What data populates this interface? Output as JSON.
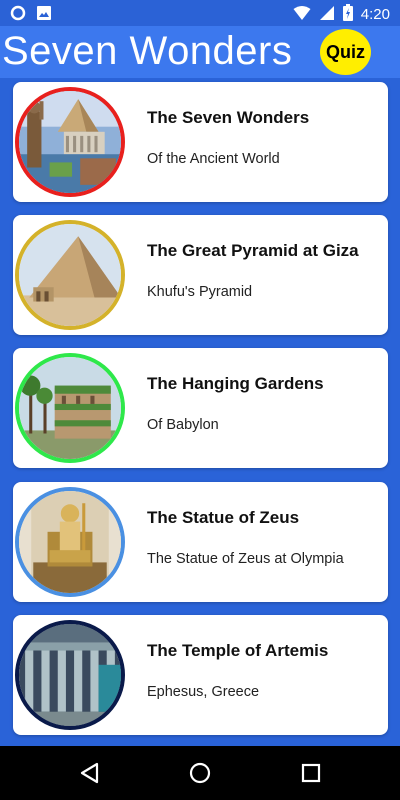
{
  "status_bar": {
    "time": "4:20",
    "left_icons": [
      "circle-notification-icon",
      "image-notification-icon"
    ],
    "right_icons": [
      "wifi-icon",
      "signal-icon",
      "battery-charging-icon"
    ]
  },
  "app_bar": {
    "title": "Seven Wonders",
    "quiz_label": "Quiz",
    "quiz_color": "#ffee00"
  },
  "wonders": [
    {
      "title": "The Seven Wonders",
      "subtitle": "Of the Ancient World",
      "border_color": "#e8201d",
      "image": "seven-wonders-collage-image"
    },
    {
      "title": "The Great Pyramid at Giza",
      "subtitle": "Khufu's Pyramid",
      "border_color": "#d4b22a",
      "image": "great-pyramid-image"
    },
    {
      "title": "The Hanging Gardens",
      "subtitle": "Of Babylon",
      "border_color": "#2ee84a",
      "image": "hanging-gardens-image"
    },
    {
      "title": "The Statue of Zeus",
      "subtitle": "The Statue of Zeus at Olympia",
      "border_color": "#4a90e2",
      "image": "statue-of-zeus-image"
    },
    {
      "title": "The Temple of Artemis",
      "subtitle": "Ephesus, Greece",
      "border_color": "#0a1a4a",
      "image": "temple-of-artemis-image"
    }
  ],
  "nav_bar": {
    "icons": [
      "back-icon",
      "home-icon",
      "recents-icon"
    ]
  }
}
